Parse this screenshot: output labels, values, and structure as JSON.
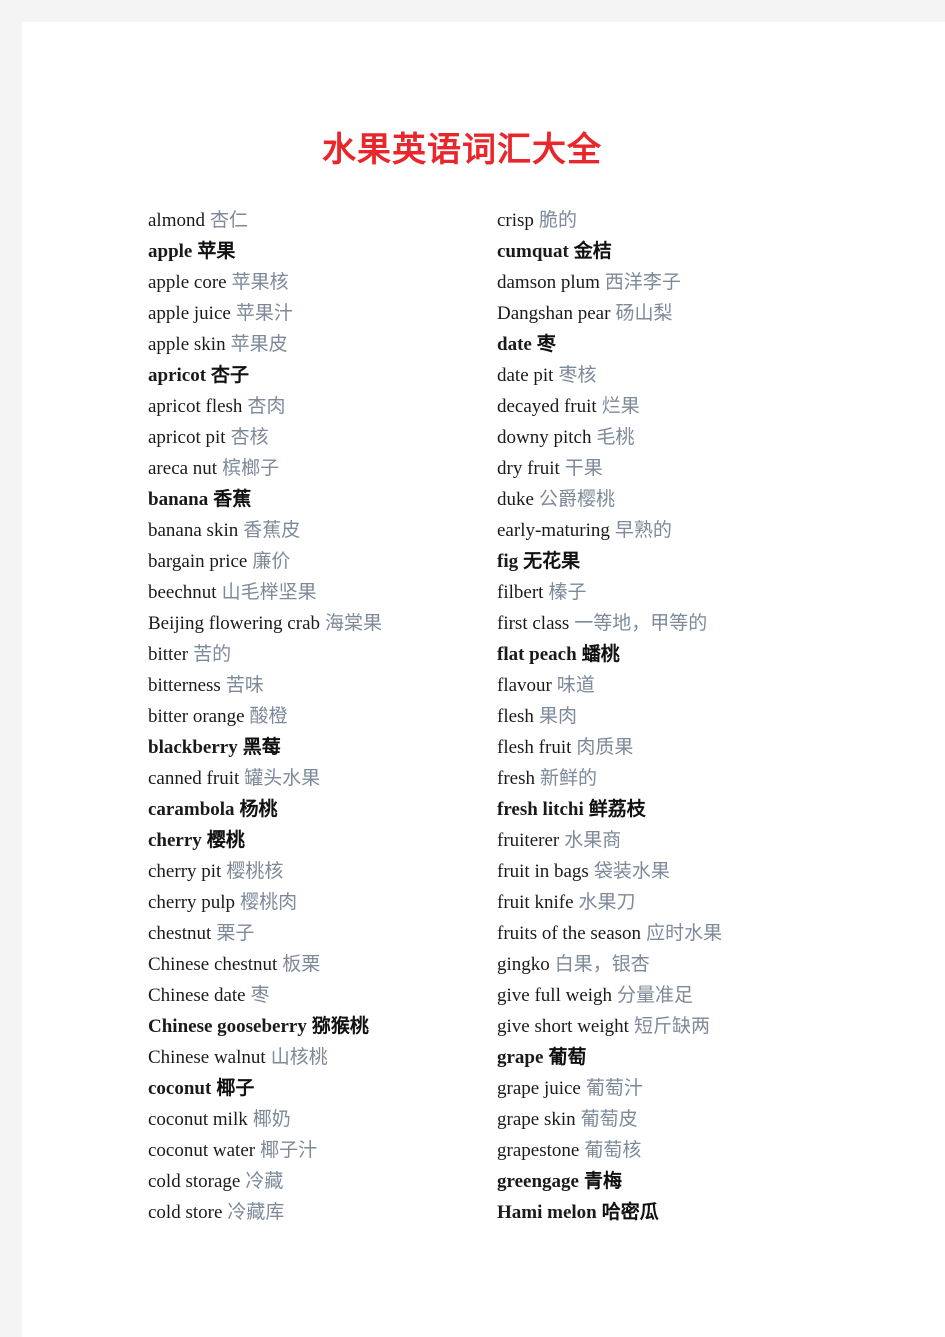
{
  "document": {
    "title": "水果英语词汇大全",
    "title_color": "#e8262b",
    "page_background": "#ffffff",
    "canvas_background": "#f4f4f4",
    "chinese_text_color": "#7e8a9a",
    "english_text_color": "#1a1a1a"
  },
  "columns": {
    "left": [
      {
        "en": "almond",
        "zh": "杏仁",
        "bold": false
      },
      {
        "en": "apple",
        "zh": "苹果",
        "bold": true
      },
      {
        "en": "apple core",
        "zh": "苹果核",
        "bold": false
      },
      {
        "en": "apple juice",
        "zh": "苹果汁",
        "bold": false
      },
      {
        "en": "apple skin",
        "zh": "苹果皮",
        "bold": false
      },
      {
        "en": "apricot",
        "zh": "杏子",
        "bold": true
      },
      {
        "en": "apricot flesh",
        "zh": "杏肉",
        "bold": false
      },
      {
        "en": "apricot pit",
        "zh": "杏核",
        "bold": false
      },
      {
        "en": "areca nut",
        "zh": "槟榔子",
        "bold": false
      },
      {
        "en": "banana",
        "zh": "香蕉",
        "bold": true
      },
      {
        "en": "banana skin",
        "zh": "香蕉皮",
        "bold": false
      },
      {
        "en": "bargain price",
        "zh": "廉价",
        "bold": false
      },
      {
        "en": "beechnut",
        "zh": "山毛榉坚果",
        "bold": false
      },
      {
        "en": "Beijing flowering crab",
        "zh": "海棠果",
        "bold": false
      },
      {
        "en": "bitter",
        "zh": "苦的",
        "bold": false
      },
      {
        "en": "bitterness",
        "zh": "苦味",
        "bold": false
      },
      {
        "en": "bitter orange",
        "zh": "酸橙",
        "bold": false
      },
      {
        "en": "blackberry",
        "zh": "黑莓",
        "bold": true
      },
      {
        "en": "canned fruit",
        "zh": "罐头水果",
        "bold": false
      },
      {
        "en": "carambola",
        "zh": "杨桃",
        "bold": true
      },
      {
        "en": "cherry",
        "zh": "樱桃",
        "bold": true
      },
      {
        "en": "cherry pit",
        "zh": "樱桃核",
        "bold": false
      },
      {
        "en": "cherry pulp",
        "zh": "樱桃肉",
        "bold": false
      },
      {
        "en": "chestnut",
        "zh": "栗子",
        "bold": false
      },
      {
        "en": "Chinese chestnut",
        "zh": "板栗",
        "bold": false
      },
      {
        "en": "Chinese date",
        "zh": "枣",
        "bold": false
      },
      {
        "en": "Chinese gooseberry",
        "zh": "猕猴桃",
        "bold": true
      },
      {
        "en": "Chinese walnut",
        "zh": "山核桃",
        "bold": false
      },
      {
        "en": "coconut",
        "zh": "椰子",
        "bold": true
      },
      {
        "en": "coconut milk",
        "zh": "椰奶",
        "bold": false
      },
      {
        "en": "coconut water",
        "zh": "椰子汁",
        "bold": false
      },
      {
        "en": "cold storage",
        "zh": "冷藏",
        "bold": false
      },
      {
        "en": "cold store",
        "zh": "冷藏库",
        "bold": false
      }
    ],
    "right": [
      {
        "en": "crisp",
        "zh": "脆的",
        "bold": false
      },
      {
        "en": "cumquat",
        "zh": "金桔",
        "bold": true
      },
      {
        "en": "damson plum",
        "zh": "西洋李子",
        "bold": false
      },
      {
        "en": "Dangshan pear",
        "zh": "砀山梨",
        "bold": false
      },
      {
        "en": "date",
        "zh": "枣",
        "bold": true
      },
      {
        "en": "date pit",
        "zh": "枣核",
        "bold": false
      },
      {
        "en": "decayed fruit",
        "zh": "烂果",
        "bold": false
      },
      {
        "en": "downy pitch",
        "zh": "毛桃",
        "bold": false
      },
      {
        "en": "dry fruit",
        "zh": "干果",
        "bold": false
      },
      {
        "en": "duke",
        "zh": "公爵樱桃",
        "bold": false
      },
      {
        "en": "early-maturing",
        "zh": "早熟的",
        "bold": false
      },
      {
        "en": "fig",
        "zh": "无花果",
        "bold": true
      },
      {
        "en": "filbert",
        "zh": "榛子",
        "bold": false
      },
      {
        "en": "first class",
        "zh": "一等地，甲等的",
        "bold": false
      },
      {
        "en": "flat peach",
        "zh": "蟠桃",
        "bold": true
      },
      {
        "en": "flavour",
        "zh": "味道",
        "bold": false
      },
      {
        "en": "flesh",
        "zh": "果肉",
        "bold": false
      },
      {
        "en": "flesh fruit",
        "zh": "肉质果",
        "bold": false
      },
      {
        "en": "fresh",
        "zh": "新鲜的",
        "bold": false
      },
      {
        "en": "fresh litchi",
        "zh": "鲜荔枝",
        "bold": true
      },
      {
        "en": "fruiterer",
        "zh": "水果商",
        "bold": false
      },
      {
        "en": "fruit in bags",
        "zh": "袋装水果",
        "bold": false
      },
      {
        "en": "fruit knife",
        "zh": "水果刀",
        "bold": false
      },
      {
        "en": "fruits of the season",
        "zh": "应时水果",
        "bold": false
      },
      {
        "en": "gingko",
        "zh": "白果，银杏",
        "bold": false
      },
      {
        "en": "give full weigh",
        "zh": "分量准足",
        "bold": false
      },
      {
        "en": "give short weight",
        "zh": "短斤缺两",
        "bold": false
      },
      {
        "en": "grape",
        "zh": "葡萄",
        "bold": true
      },
      {
        "en": "grape juice",
        "zh": "葡萄汁",
        "bold": false
      },
      {
        "en": "grape skin",
        "zh": "葡萄皮",
        "bold": false
      },
      {
        "en": "grapestone",
        "zh": "葡萄核",
        "bold": false
      },
      {
        "en": "greengage",
        "zh": "青梅",
        "bold": true
      },
      {
        "en": "Hami melon",
        "zh": "哈密瓜",
        "bold": true
      }
    ]
  }
}
